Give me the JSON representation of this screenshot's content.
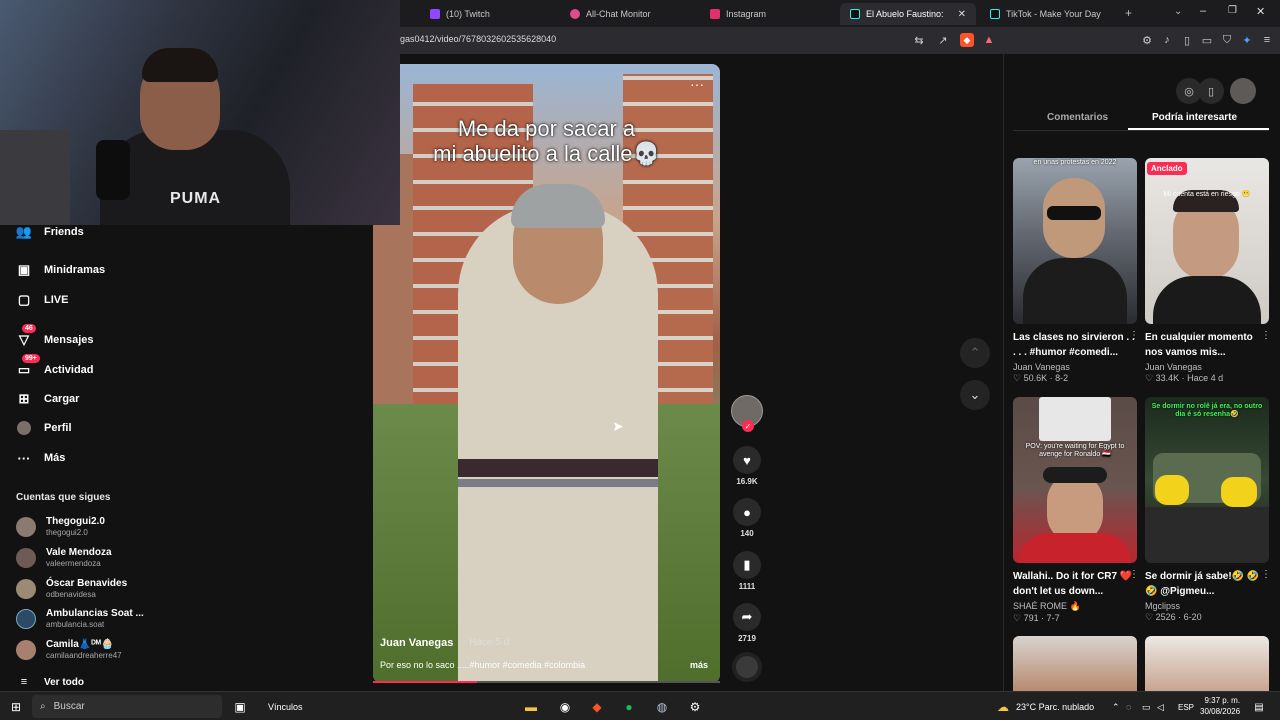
{
  "browser": {
    "tabs": [
      {
        "label": "(10) Twitch",
        "icon": "twitch-icon",
        "color": "#9146ff"
      },
      {
        "label": "All-Chat Monitor",
        "icon": "allchat-icon",
        "color": "#e04b8a"
      },
      {
        "label": "Instagram",
        "icon": "instagram-icon",
        "color": "#e1306c"
      },
      {
        "label": "El Abuelo Faustino: Por Es",
        "icon": "tiktok-icon",
        "color": "#25f4ee"
      },
      {
        "label": "TikTok - Make Your Day",
        "icon": "tiktok-icon",
        "color": "#25f4ee"
      }
    ],
    "url": "gas0412/video/7678032602535628040"
  },
  "sidebar": {
    "items": [
      {
        "label": "Friends",
        "icon": "friends-icon"
      },
      {
        "label": "Minidramas",
        "icon": "minidramas-icon"
      },
      {
        "label": "LIVE",
        "icon": "live-icon"
      },
      {
        "label": "Mensajes",
        "icon": "messages-icon",
        "badge": "46"
      },
      {
        "label": "Actividad",
        "icon": "activity-icon",
        "badge": "99+"
      },
      {
        "label": "Cargar",
        "icon": "upload-icon"
      },
      {
        "label": "Perfil",
        "icon": "profile-icon"
      },
      {
        "label": "Más",
        "icon": "more-icon"
      }
    ],
    "following_title": "Cuentas que sigues",
    "following": [
      {
        "name": "Thegogui2.0",
        "handle": "thegogui2.0"
      },
      {
        "name": "Vale Mendoza",
        "handle": "valeermendoza"
      },
      {
        "name": "Óscar Benavides",
        "handle": "odbenavidesa"
      },
      {
        "name": "Ambulancias Soat ...",
        "handle": "ambulancia.soat"
      },
      {
        "name": "Camila👗ᴰᴹ🧁",
        "handle": "camilaandreaherre47"
      }
    ],
    "see_all": "Ver todo"
  },
  "video": {
    "caption_line1": "Me da por sacar a",
    "caption_line2": "mi abuelito a la calle💀",
    "author": "Juan Vanegas",
    "time": "· Hace 5 d",
    "description": "Por eso no lo saco .....#humor #comedia #colombia",
    "more": "más",
    "progress": 0.3
  },
  "actions": {
    "likes": "16.9K",
    "comments": "140",
    "saves": "1111",
    "shares": "2719"
  },
  "right_panel": {
    "tabs": [
      "Comentarios",
      "Podría interesarte"
    ],
    "active_tab": 1,
    "cards": [
      {
        "title": "Las clases no sirvieron . . . . . #humor #comedi...",
        "author": "Juan Vanegas",
        "stats": "♡ 50.6K · 8-2",
        "thumb_text": "en unas protestas en 2022",
        "pinned": ""
      },
      {
        "title": "En cualquier momento nos vamos mis...",
        "author": "Juan Vanegas",
        "stats": "♡ 33.4K · Hace 4 d",
        "thumb_text": "Mi cuenta está en riesgo 😬",
        "pinned": "Anclado"
      },
      {
        "title": "Wallahi.. Do it for CR7 ❤️ don't let us down...",
        "author": "SHAÉ ROME 🔥",
        "stats": "♡ 791 · 7-7",
        "thumb_text": "POV: you're waiting for Egypt to avenge for Ronaldo 🇪🇬",
        "pinned": ""
      },
      {
        "title": "Se dormir já sabe!🤣 🤣 🤣 @Pigmeu...",
        "author": "Mgclipss",
        "stats": "♡ 2526 · 6-20",
        "thumb_text": "Se dormir no rolê já era, no outro dia é só resenha🤣",
        "pinned": ""
      }
    ]
  },
  "taskbar": {
    "search_placeholder": "Buscar",
    "links_label": "Vínculos",
    "weather": "23°C  Parc. nublado",
    "lang": "ESP",
    "time": "9:37 p. m.",
    "date": "30/08/2026"
  }
}
